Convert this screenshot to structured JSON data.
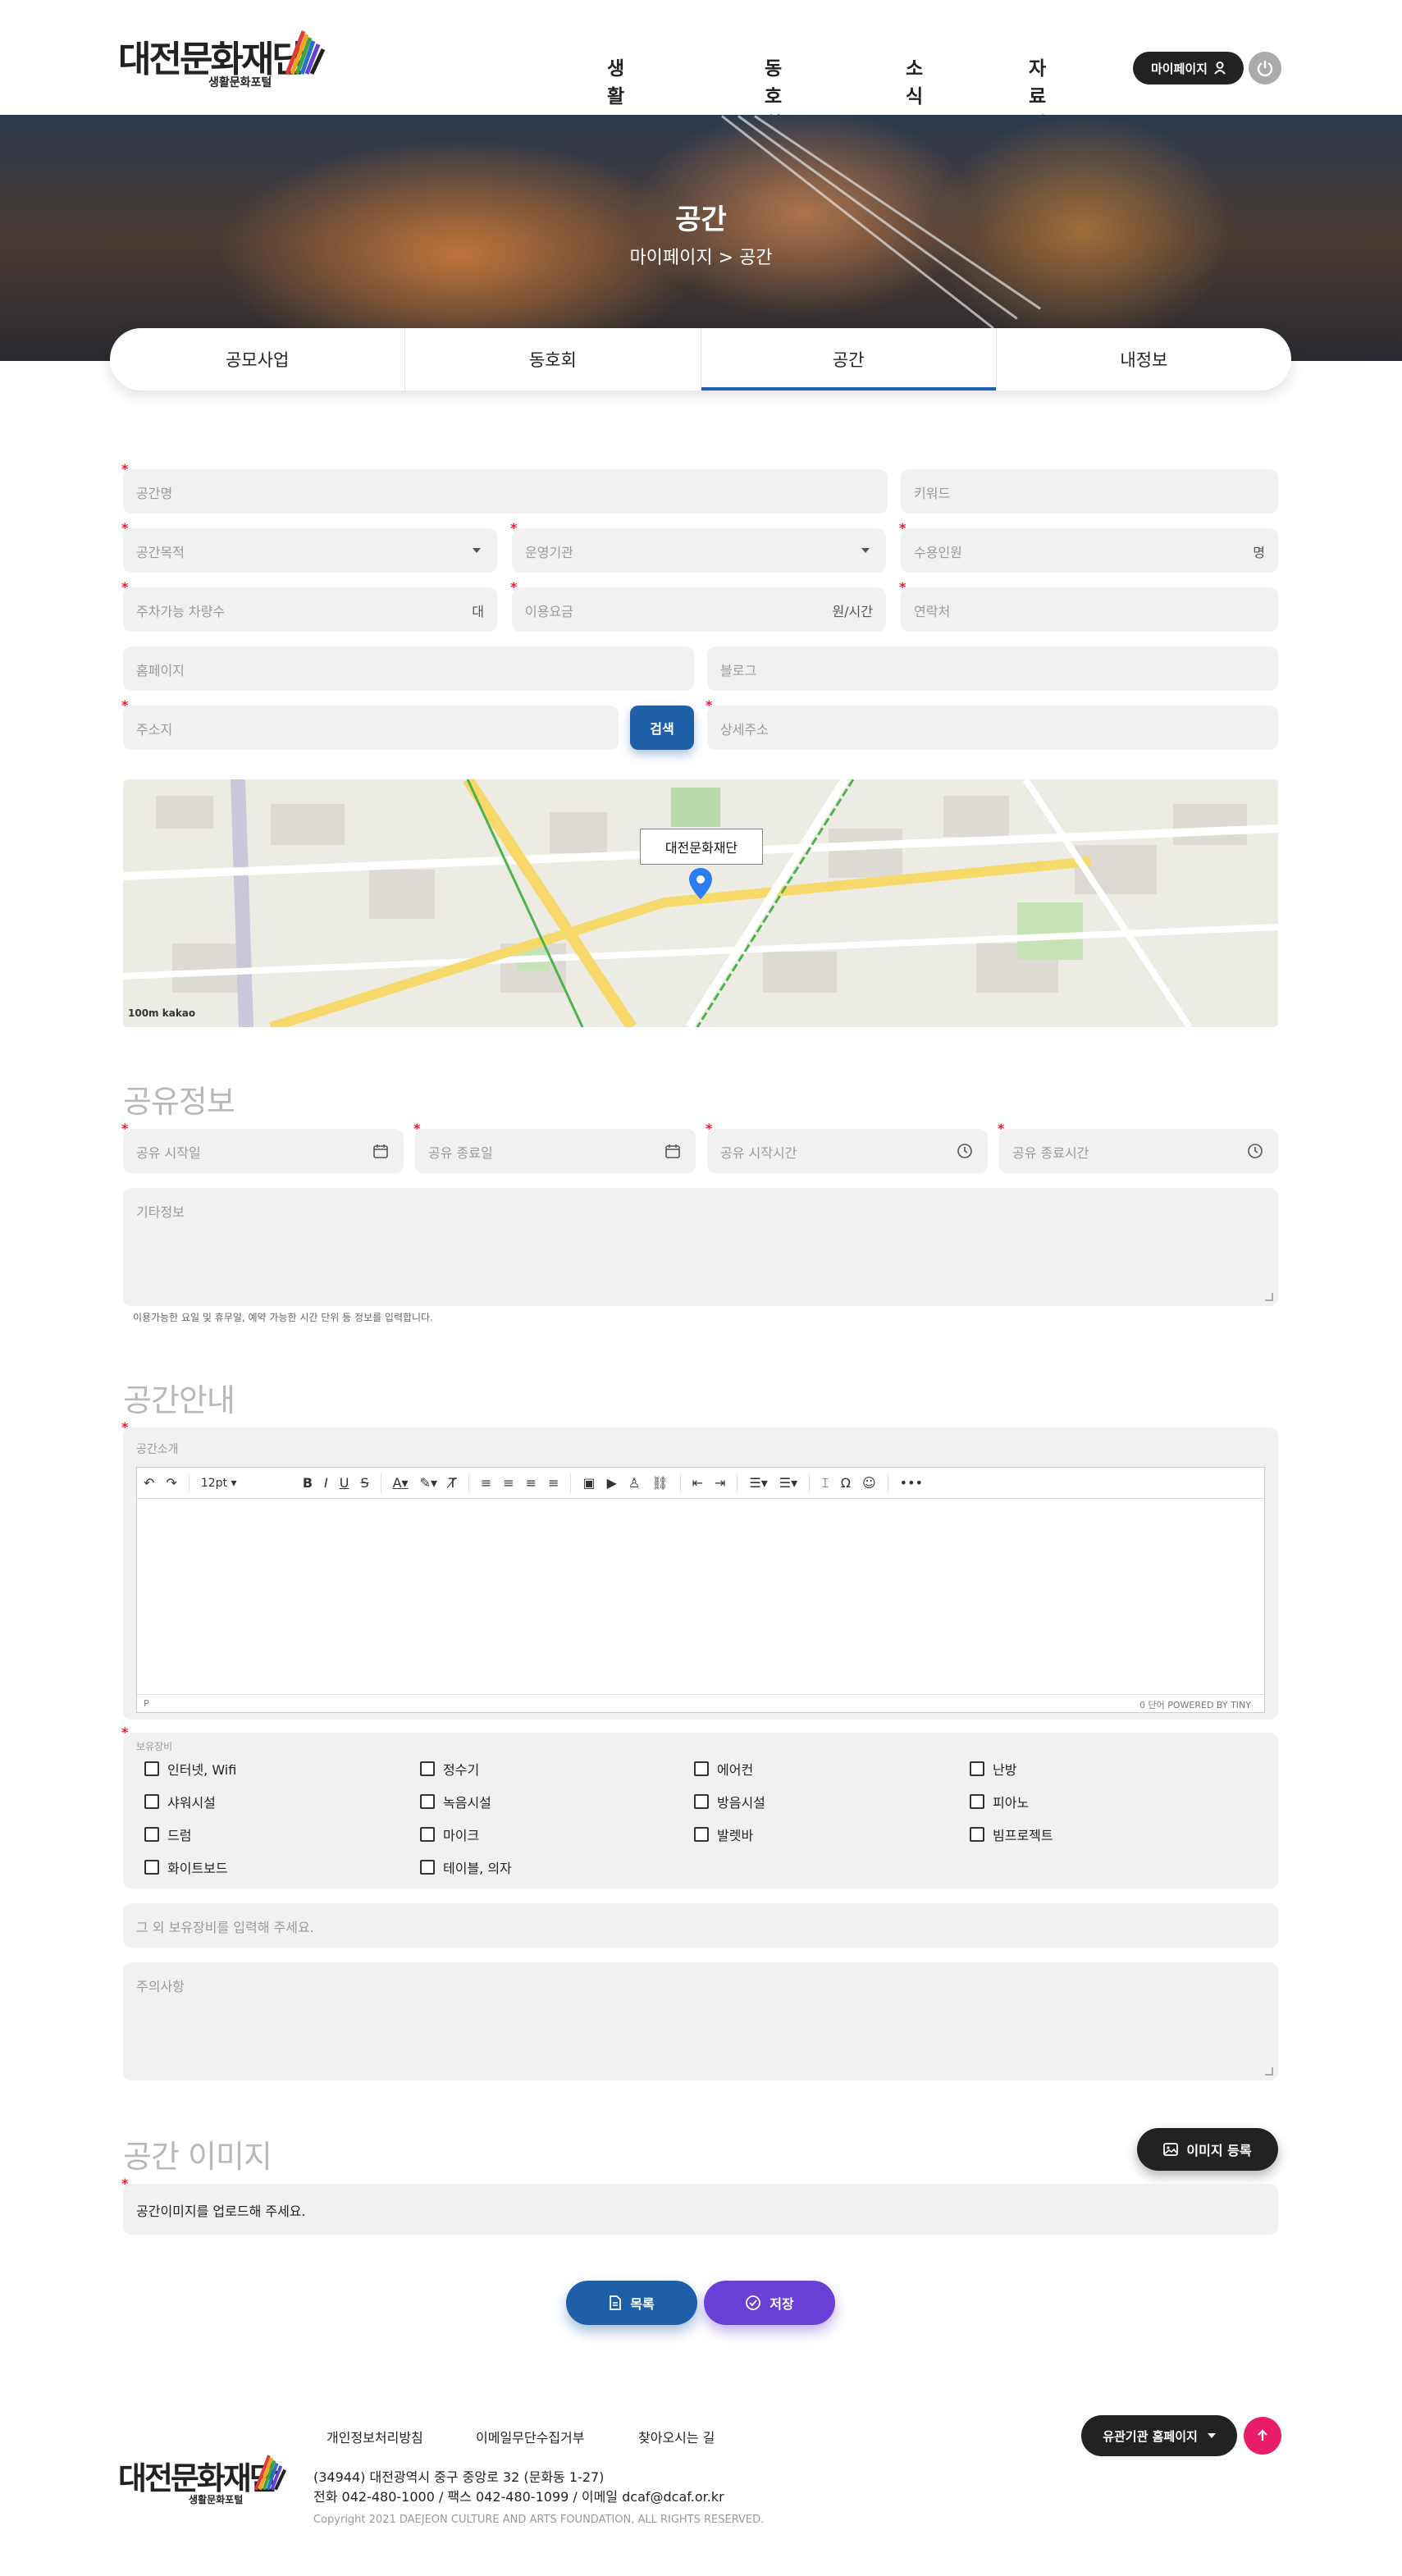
{
  "header": {
    "logo_text": "대전문화재단",
    "logo_sub": "생활문화포털",
    "nav": [
      "생활문화",
      "동호회",
      "소식",
      "자료실"
    ],
    "mypage_label": "마이페이지"
  },
  "hero": {
    "title": "공간",
    "breadcrumb": "마이페이지 > 공간"
  },
  "tabs": [
    {
      "label": "공모사업",
      "active": false
    },
    {
      "label": "동호회",
      "active": false
    },
    {
      "label": "공간",
      "active": true
    },
    {
      "label": "내정보",
      "active": false
    }
  ],
  "form": {
    "space_name": "공간명",
    "keyword": "키워드",
    "purpose": "공간목적",
    "operator": "운영기관",
    "capacity": "수용인원",
    "capacity_unit": "명",
    "parking": "주차가능 차량수",
    "parking_unit": "대",
    "fee": "이용요금",
    "fee_unit": "원/시간",
    "contact": "연락처",
    "homepage": "홈페이지",
    "blog": "블로그",
    "address": "주소지",
    "search_label": "검색",
    "detail_address": "상세주소"
  },
  "map": {
    "label": "대전문화재단",
    "attribution": "kakao",
    "scale": "100m"
  },
  "share": {
    "title": "공유정보",
    "start_date": "공유 시작일",
    "end_date": "공유 종료일",
    "start_time": "공유 시작시간",
    "end_time": "공유 종료시간",
    "etc": "기타정보",
    "hint": "이용가능한 요일 및 휴무일, 예약 가능한 시간 단위 등 정보를 입력합니다."
  },
  "guide": {
    "title": "공간안내",
    "intro_label": "공간소개",
    "font_size": "12pt",
    "status_left": "P",
    "status_right": "0 단어   POWERED BY TINY",
    "equip_label": "보유장비",
    "equipment": [
      [
        "인터넷, Wifi",
        "정수기",
        "에어컨",
        "난방"
      ],
      [
        "샤워시설",
        "녹음시설",
        "방음시설",
        "피아노"
      ],
      [
        "드럼",
        "마이크",
        "발렛바",
        "빔프로젝트"
      ],
      [
        "화이트보드",
        "테이블, 의자"
      ]
    ],
    "other_equip": "그 외 보유장비를 입력해 주세요.",
    "caution": "주의사항"
  },
  "image": {
    "title": "공간 이미지",
    "register_label": "이미지 등록",
    "upload_prompt": "공간이미지를 업로드해 주세요."
  },
  "actions": {
    "list_label": "목록",
    "save_label": "저장"
  },
  "footer": {
    "logo_text": "대전문화재단",
    "logo_sub": "생활문화포털",
    "links": [
      "개인정보처리방침",
      "이메일무단수집거부",
      "찾아오시는 길"
    ],
    "address": "(34944) 대전광역시 중구 중앙로 32 (문화동 1-27)",
    "contact": "전화 042-480-1000 / 팩스 042-480-1099 / 이메일 dcaf@dcaf.or.kr",
    "copyright": "Copyright 2021 DAEJEON CULTURE AND ARTS FOUNDATION, ALL RIGHTS RESERVED.",
    "related_label": "유관기관 홈페이지"
  },
  "colors": {
    "primary_blue": "#1e5fa8",
    "save_purple": "#6a3fd6",
    "required_red": "#e0203a",
    "top_pink": "#ea1d6a",
    "dark": "#222222",
    "field_bg": "#f1f1f1"
  }
}
